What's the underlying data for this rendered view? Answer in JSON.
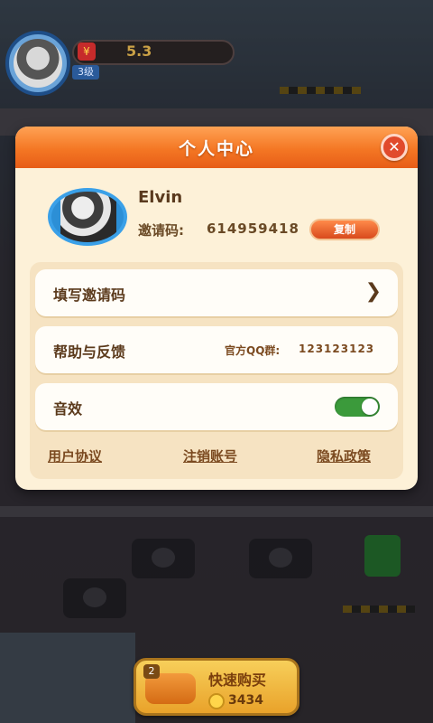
{
  "hud": {
    "value": "5.3",
    "level": "3级"
  },
  "modal": {
    "title": "个人中心",
    "close_icon": "close-icon",
    "profile": {
      "name": "Elvin",
      "invite_label": "邀请码:",
      "invite_code": "614959418",
      "copy_label": "复制"
    },
    "rows": [
      {
        "label": "填写邀请码"
      },
      {
        "label": "帮助与反馈",
        "qq_label": "官方QQ群:",
        "qq_value": "123123123"
      },
      {
        "label": "音效",
        "toggle_on": true
      }
    ],
    "footer": {
      "user_agreement": "用户协议",
      "cancel_account": "注销账号",
      "privacy_policy": "隐私政策"
    }
  },
  "buy_button": {
    "level": "2",
    "label": "快速购买",
    "price": "3434"
  },
  "colors": {
    "header_orange": "#f47724",
    "modal_bg": "#fdf1d8",
    "toggle_green": "#3b9a3b",
    "text_brown": "#5b3a1c"
  }
}
